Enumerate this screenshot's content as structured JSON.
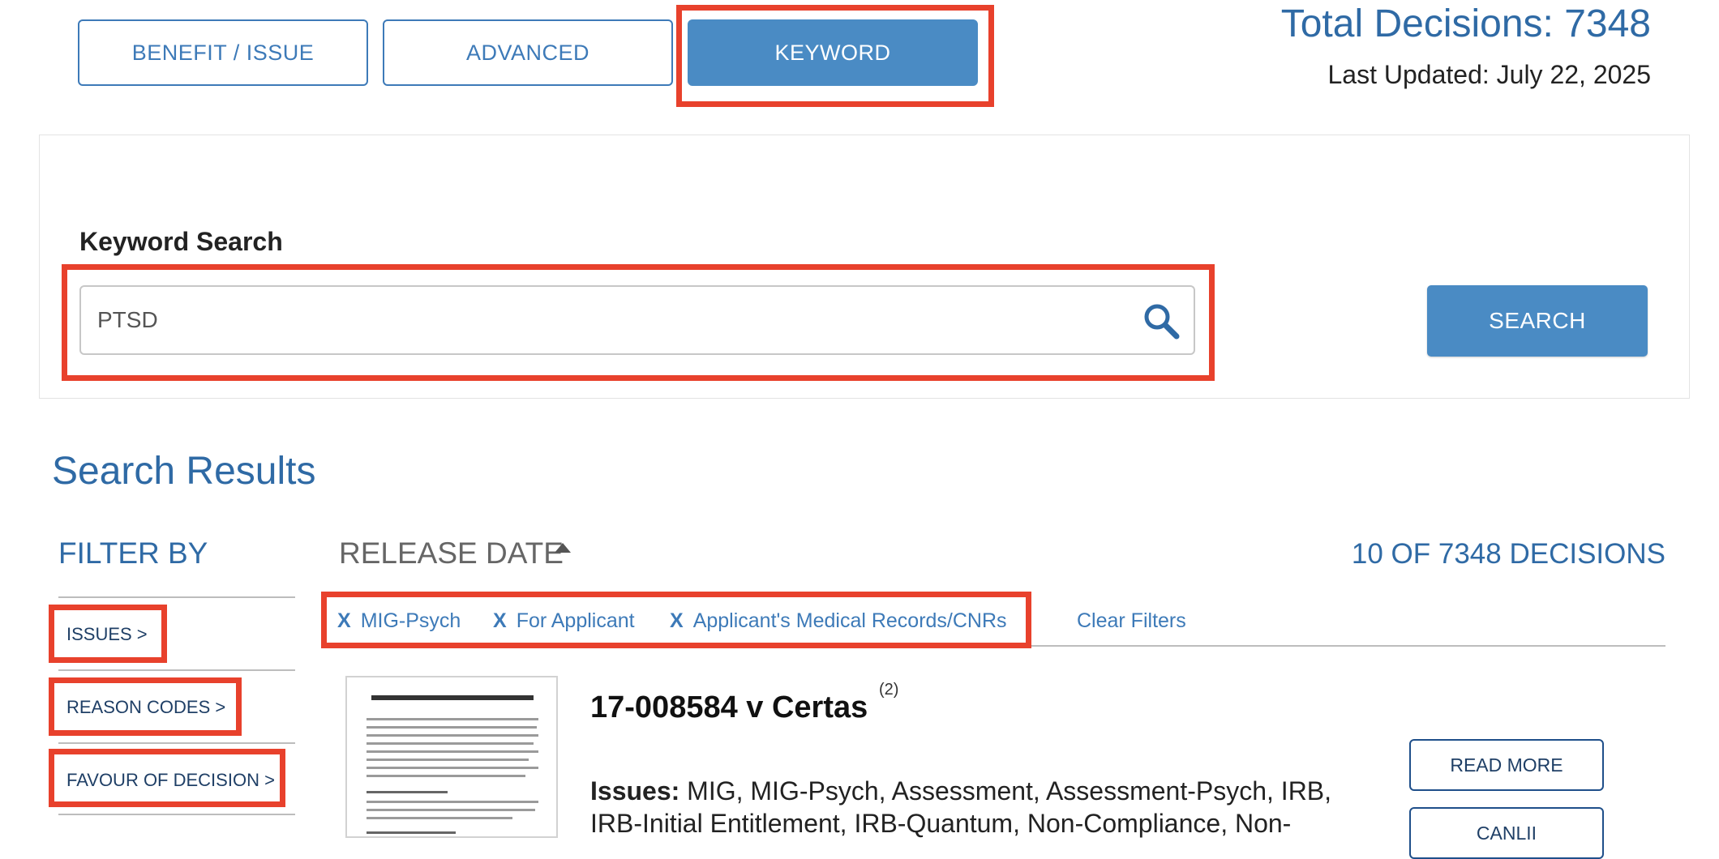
{
  "tabs": [
    {
      "label": "BENEFIT / ISSUE",
      "active": false
    },
    {
      "label": "ADVANCED",
      "active": false
    },
    {
      "label": "KEYWORD",
      "active": true
    }
  ],
  "header": {
    "total_decisions": "Total Decisions: 7348",
    "last_updated": "Last Updated: July 22, 2025"
  },
  "search": {
    "label": "Keyword Search",
    "value": "PTSD",
    "button_label": "SEARCH",
    "icon": "search-icon"
  },
  "results": {
    "title": "Search Results",
    "sort_label": "RELEASE DATE",
    "count_text": "10 OF 7348 DECISIONS"
  },
  "filters": {
    "heading": "FILTER BY",
    "items": [
      {
        "label": "ISSUES >"
      },
      {
        "label": "REASON CODES >"
      },
      {
        "label": "FAVOUR OF DECISION >"
      }
    ]
  },
  "active_filters": {
    "remove_glyph": "X",
    "chips": [
      {
        "label": "MIG-Psych"
      },
      {
        "label": "For Applicant"
      },
      {
        "label": "Applicant's Medical Records/CNRs"
      }
    ],
    "clear_label": "Clear Filters"
  },
  "result_item": {
    "title": "17-008584 v Certas",
    "superscript": "(2)",
    "issues_label": "Issues:",
    "issues_text": "MIG, MIG-Psych, Assessment, Assessment-Psych, IRB, IRB-Initial Entitlement, IRB-Quantum, Non-Compliance, Non-",
    "read_more_label": "READ MORE",
    "canlii_label": "CANLII"
  },
  "colors": {
    "primary_blue": "#2f6aa5",
    "button_blue": "#4a8bc4",
    "highlight_red": "#e8412c"
  }
}
